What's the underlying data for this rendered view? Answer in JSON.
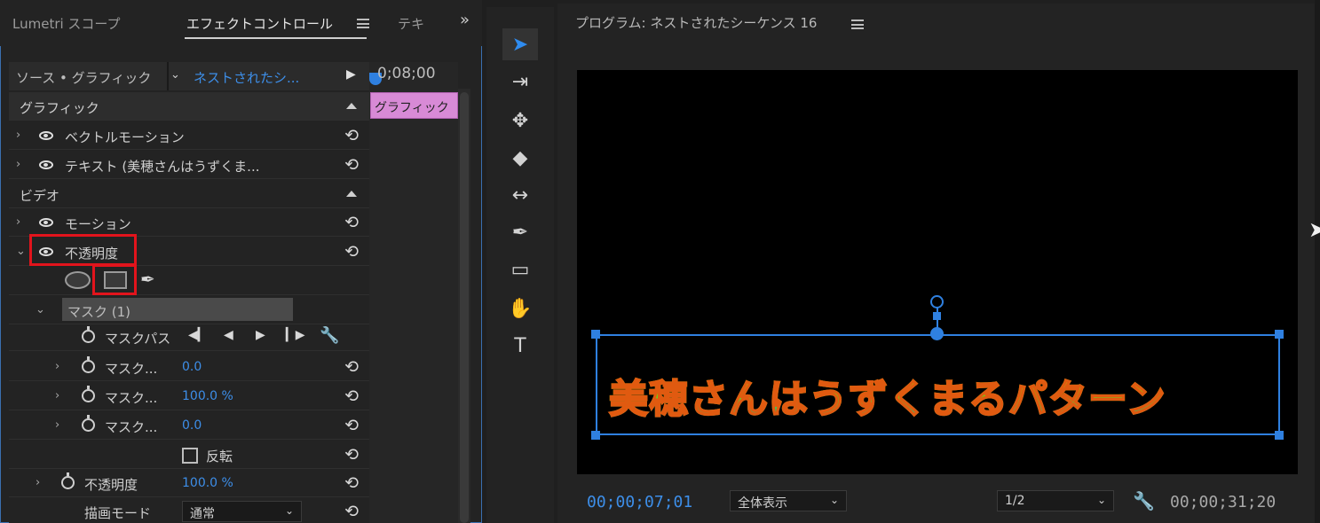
{
  "left_panel": {
    "tabs": [
      {
        "label": "Lumetri スコープ"
      },
      {
        "label": "エフェクトコントロール"
      },
      {
        "label": "テキ"
      }
    ],
    "more_label": "»",
    "source_label": "ソース • グラフィック",
    "source_sequence": "ネストされたシ...",
    "timecode_head": "0;08;00",
    "clip_label": "グラフィック",
    "sections": {
      "graphic": "グラフィック",
      "video": "ビデオ"
    },
    "rows": {
      "vector_motion": "ベクトルモーション",
      "text_layer": "テキスト (美穂さんはうずくま...",
      "motion": "モーション",
      "opacity": "不透明度",
      "mask_group": "マスク (1)",
      "mask_path": "マスクパス",
      "mask_feather_label": "マスク...",
      "mask_feather_value": "0.0",
      "mask_opacity_label": "マスク...",
      "mask_opacity_value": "100.0 %",
      "mask_expansion_label": "マスク...",
      "mask_expansion_value": "0.0",
      "invert_label": "反転",
      "opacity_prop_label": "不透明度",
      "opacity_prop_value": "100.0 %",
      "blend_mode_label": "描画モード",
      "blend_mode_value": "通常"
    }
  },
  "tools": [
    {
      "name": "selection-tool",
      "glyph": "➤"
    },
    {
      "name": "track-select-tool",
      "glyph": "⇥"
    },
    {
      "name": "ripple-edit-tool",
      "glyph": "✥"
    },
    {
      "name": "razor-tool",
      "glyph": "◆"
    },
    {
      "name": "slip-tool",
      "glyph": "↔"
    },
    {
      "name": "pen-tool",
      "glyph": "✒"
    },
    {
      "name": "rectangle-tool",
      "glyph": "▭"
    },
    {
      "name": "hand-tool",
      "glyph": "✋"
    },
    {
      "name": "type-tool",
      "glyph": "T"
    }
  ],
  "program": {
    "title": "プログラム: ネストされたシーケンス 16",
    "caption": "美穂さんはうずくまるパターン",
    "timecode_current": "00;00;07;01",
    "zoom_select": "全体表示",
    "resolution_select": "1/2",
    "timecode_total": "00;00;31;20"
  },
  "colors": {
    "accent": "#3d8ee8",
    "highlight_box": "#e2141c",
    "caption_gradient_top": "#f0d000",
    "caption_gradient_bottom": "#00b8b0",
    "caption_outline": "#e05a10"
  }
}
